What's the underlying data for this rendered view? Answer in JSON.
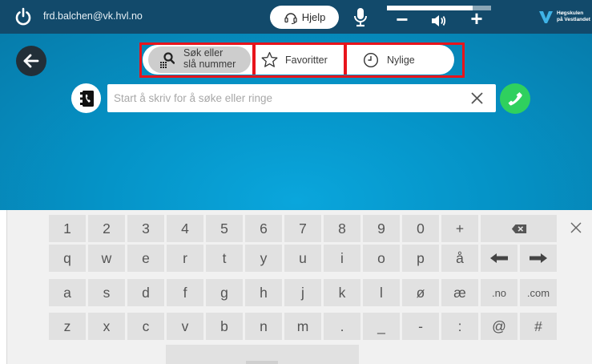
{
  "topbar": {
    "user_email": "frd.balchen@vk.hvl.no",
    "help_label": "Hjelp",
    "volume_level": 0.82,
    "vol_minus": "−",
    "vol_plus": "+",
    "logo_line1": "Høgskulen",
    "logo_line2": "på Vestlandet"
  },
  "tabs": {
    "search_line1": "Søk eller",
    "search_line2": "slå nummer",
    "favorites": "Favoritter",
    "recent": "Nylige"
  },
  "search": {
    "placeholder": "Start å skriv for å søke eller ringe",
    "value": ""
  },
  "keyboard": {
    "rows": [
      [
        "1",
        "2",
        "3",
        "4",
        "5",
        "6",
        "7",
        "8",
        "9",
        "0",
        "+",
        "⌫"
      ],
      [
        "q",
        "w",
        "e",
        "r",
        "t",
        "y",
        "u",
        "i",
        "o",
        "p",
        "å",
        "←",
        "→"
      ],
      [
        "a",
        "s",
        "d",
        "f",
        "g",
        "h",
        "j",
        "k",
        "l",
        "ø",
        "æ",
        ".no",
        ".com"
      ],
      [
        "z",
        "x",
        "c",
        "v",
        "b",
        "n",
        "m",
        ".",
        "_",
        "-",
        ":",
        "@",
        "#"
      ]
    ]
  },
  "colors": {
    "topbar": "#124a6b",
    "highlight": "#e8141b",
    "call": "#2fd05e"
  },
  "icons": [
    "power-icon",
    "headset-icon",
    "microphone-icon",
    "speaker-icon",
    "back-arrow-icon",
    "dialpad-search-icon",
    "star-icon",
    "clock-icon",
    "phonebook-icon",
    "close-icon",
    "phone-icon",
    "backspace-icon",
    "arrow-left-icon",
    "arrow-right-icon"
  ]
}
